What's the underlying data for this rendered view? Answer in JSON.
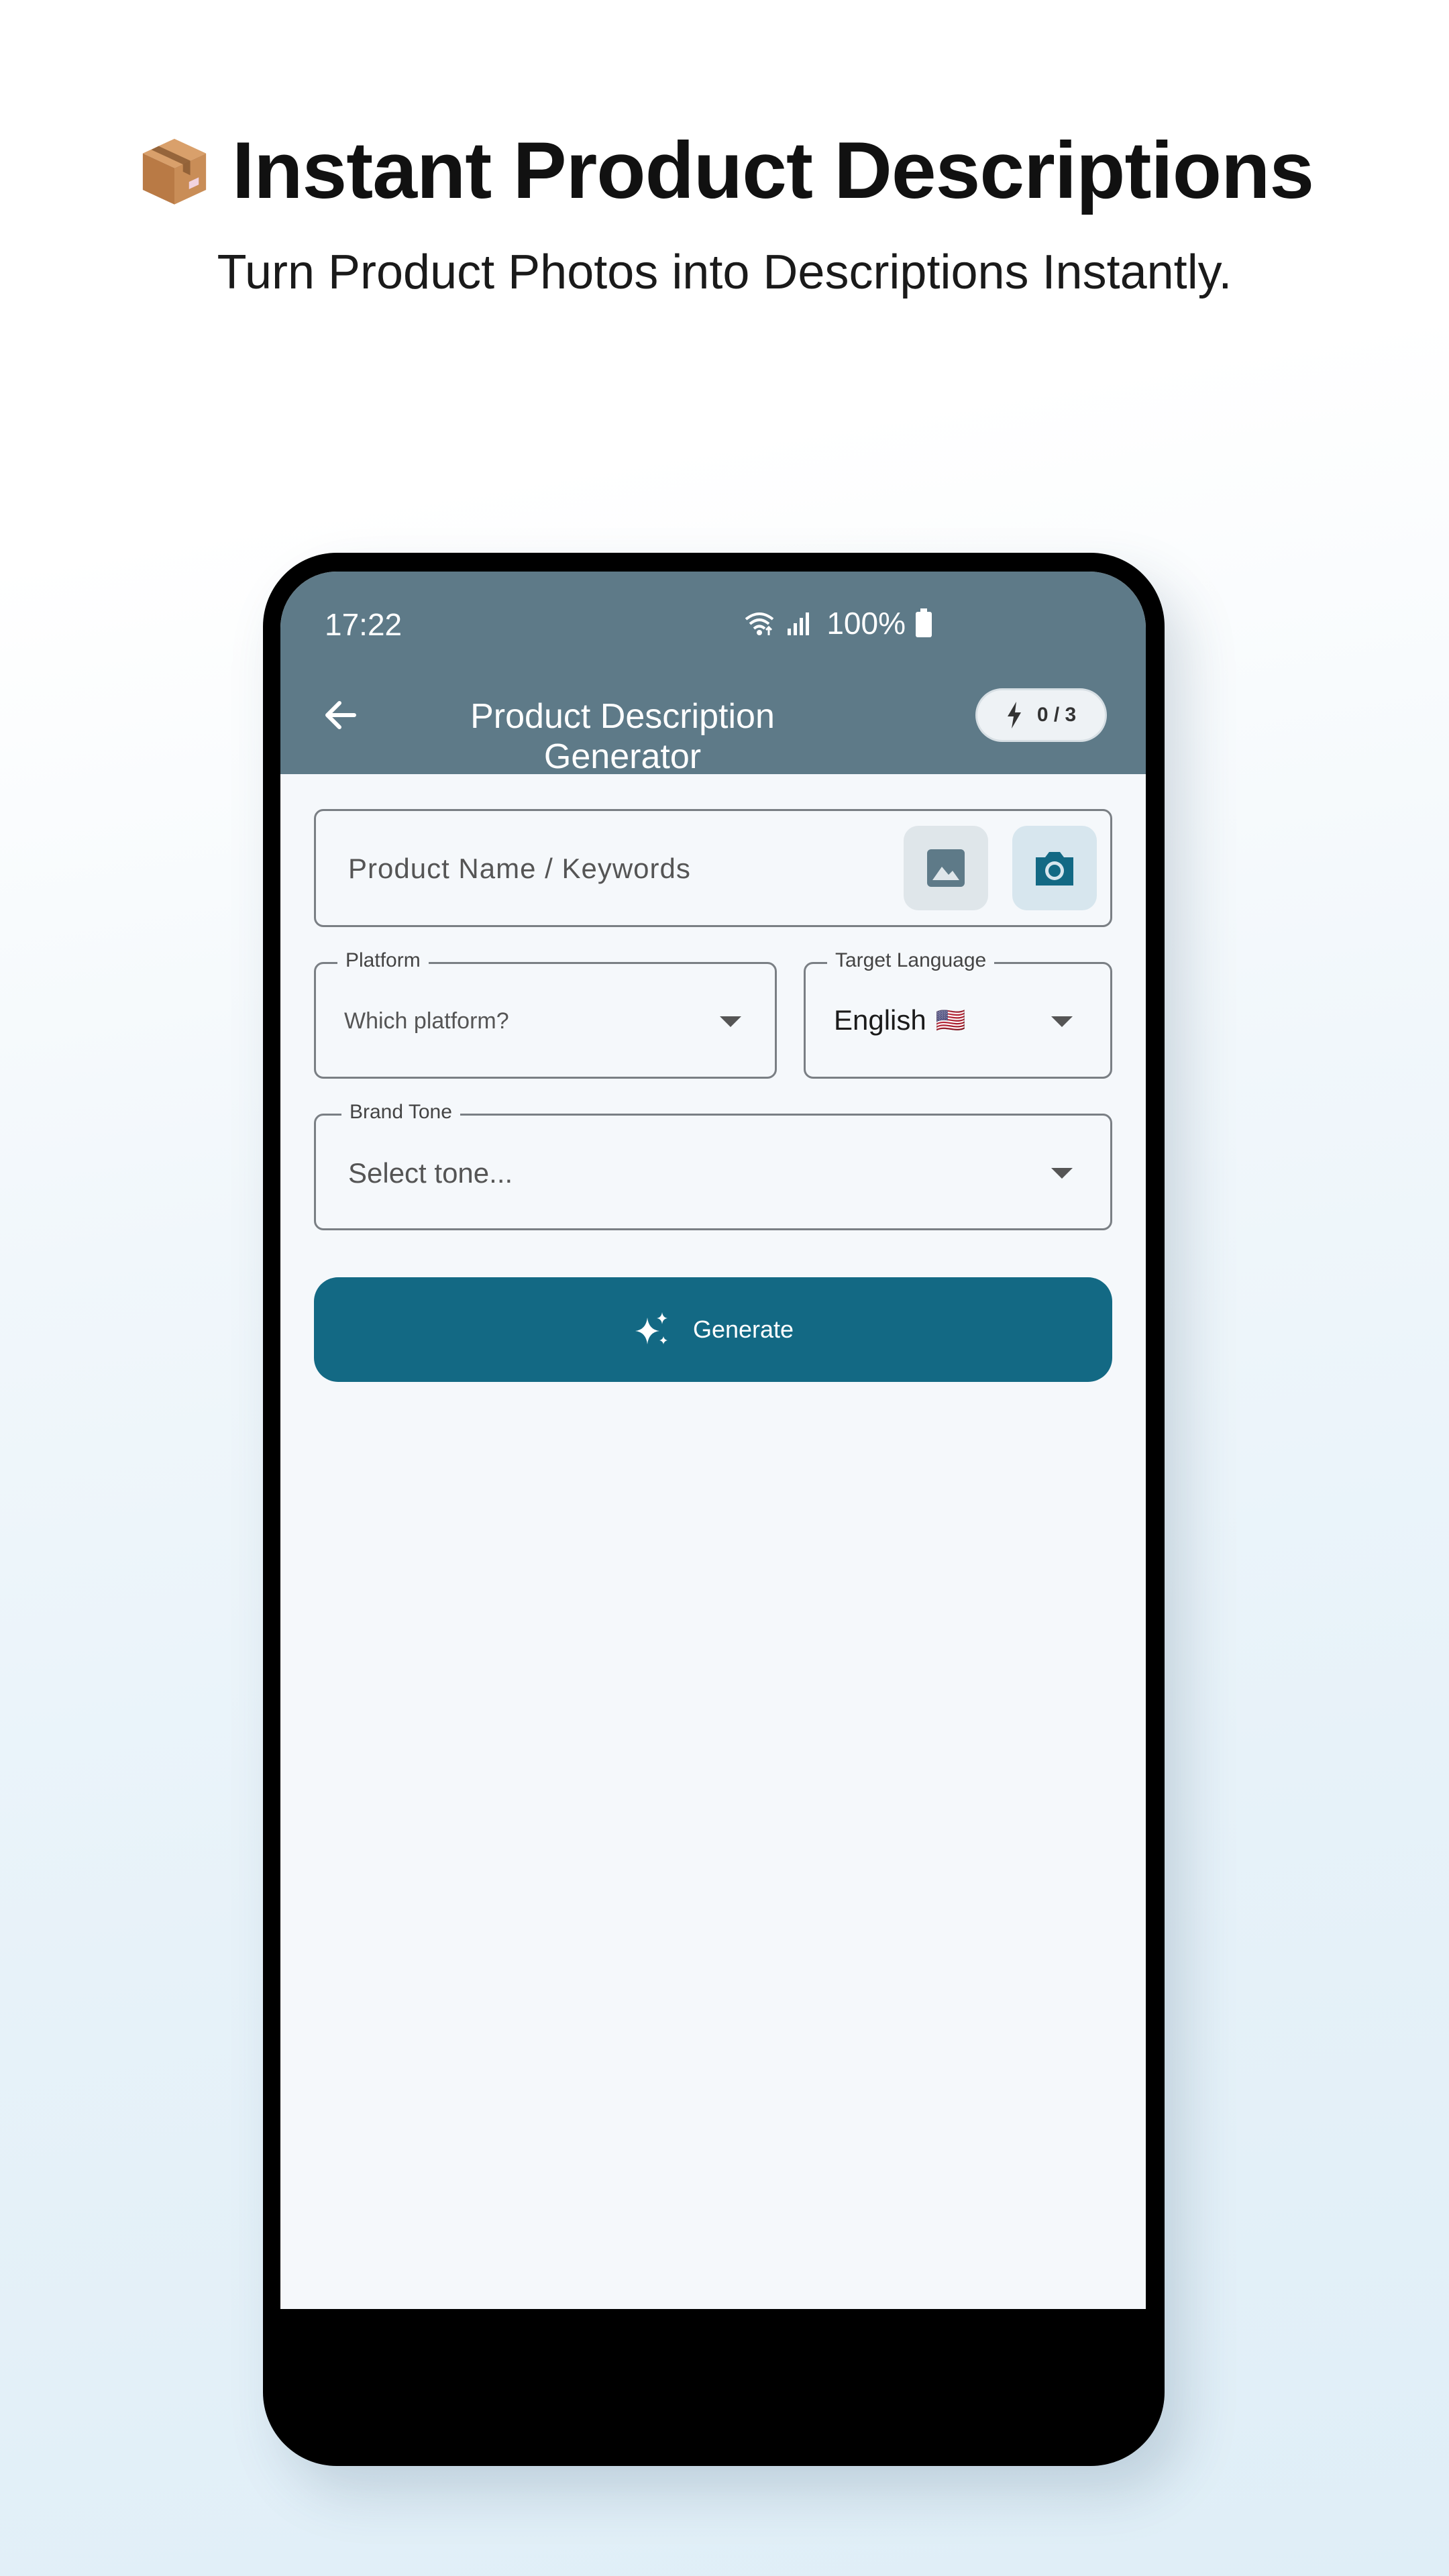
{
  "promo": {
    "emoji_icon": "package-box-icon",
    "title": "Instant Product Descriptions",
    "subtitle": "Turn Product Photos into Descriptions Instantly."
  },
  "status_bar": {
    "time": "17:22",
    "battery_percent": "100%",
    "icons": [
      "wifi-icon",
      "signal-icon",
      "battery-icon"
    ]
  },
  "app_bar": {
    "title": "Product Description Generator",
    "back_icon": "arrow-left-icon",
    "credits": "0 / 3",
    "credits_icon": "lightning-bolt-icon",
    "background_color": "#5e7a88"
  },
  "form": {
    "product_input": {
      "placeholder": "Product Name / Keywords",
      "value": ""
    },
    "gallery_button_icon": "image-gallery-icon",
    "camera_button_icon": "camera-icon",
    "platform": {
      "label": "Platform",
      "value": "Which platform?"
    },
    "target_language": {
      "label": "Target Language",
      "value": "English",
      "flag": "🇺🇸"
    },
    "brand_tone": {
      "label": "Brand Tone",
      "value": "Select tone..."
    },
    "generate_button": {
      "label": "Generate",
      "icon": "sparkles-icon",
      "color": "#136984"
    }
  }
}
